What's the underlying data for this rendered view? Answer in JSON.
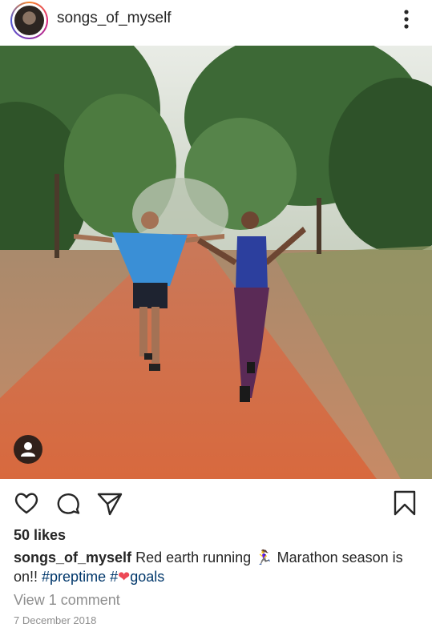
{
  "post": {
    "username": "songs_of_myself",
    "likes_text": "50 likes",
    "caption": {
      "username": "songs_of_myself",
      "text_part1": " Red earth running ",
      "emoji_runner": "🏃‍♀️",
      "text_part2": " Marathon season is on!! ",
      "hashtag1": "#preptime",
      "hashtag2_prefix": " #",
      "emoji_heart": "❤",
      "hashtag2_suffix": "goals"
    },
    "view_comments": "View 1 comment",
    "date": "7 December 2018"
  },
  "icons": {
    "more": "more-vertical-icon",
    "like": "heart-icon",
    "comment": "comment-icon",
    "share": "share-icon",
    "save": "bookmark-icon",
    "tagged": "user-tag-icon"
  },
  "colors": {
    "text": "#262626",
    "muted": "#8e8e8e",
    "hashtag": "#00376b",
    "heart": "#ed4956"
  }
}
